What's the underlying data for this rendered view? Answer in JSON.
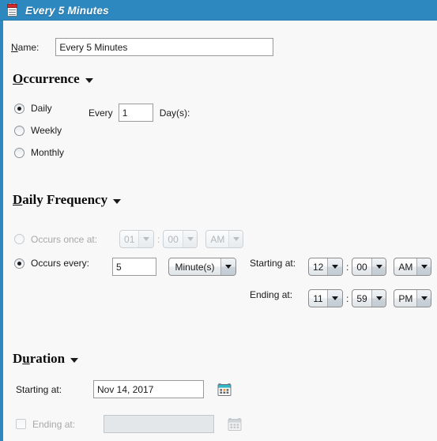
{
  "window": {
    "title": "Every 5 Minutes",
    "icon": "schedule-calendar-icon",
    "titlebar_color": "#2e88c0",
    "background_color": "#f8f8f8"
  },
  "name_field": {
    "label": "Name:",
    "label_accelerator": "N",
    "value": "Every 5 Minutes",
    "placeholder": ""
  },
  "occurrence": {
    "header": "Occurrence",
    "header_accelerator": "O",
    "collapse_icon": "triangle-down-icon",
    "options": [
      {
        "label": "Daily",
        "selected": true
      },
      {
        "label": "Weekly",
        "selected": false
      },
      {
        "label": "Monthly",
        "selected": false
      }
    ],
    "every_label": "Every",
    "every_value": "1",
    "unit_label": "Day(s):"
  },
  "daily_frequency": {
    "header": "Daily Frequency",
    "header_accelerator": "D",
    "collapse_icon": "triangle-down-icon",
    "occurs_once": {
      "label": "Occurs once at:",
      "selected": false,
      "enabled": false,
      "hour": "01",
      "minute": "00",
      "meridiem": "AM",
      "separator": ":"
    },
    "occurs_every": {
      "label": "Occurs every:",
      "selected": true,
      "enabled": true,
      "interval": "5",
      "unit": "Minute(s)",
      "starting_at_label": "Starting at:",
      "starting": {
        "hour": "12",
        "minute": "00",
        "meridiem": "AM"
      },
      "ending_at_label": "Ending at:",
      "ending": {
        "hour": "11",
        "minute": "59",
        "meridiem": "PM"
      },
      "separator": ":"
    }
  },
  "duration": {
    "header": "Duration",
    "header_accelerator": "u",
    "collapse_icon": "triangle-down-icon",
    "starting_at_label": "Starting at:",
    "starting_at_value": "Nov 14, 2017",
    "starting_at_calendar_icon": "calendar-icon",
    "ending_at_label": "Ending at:",
    "ending_at_checked": false,
    "ending_at_enabled": false,
    "ending_at_value": "",
    "ending_at_calendar_icon": "calendar-icon-disabled"
  }
}
